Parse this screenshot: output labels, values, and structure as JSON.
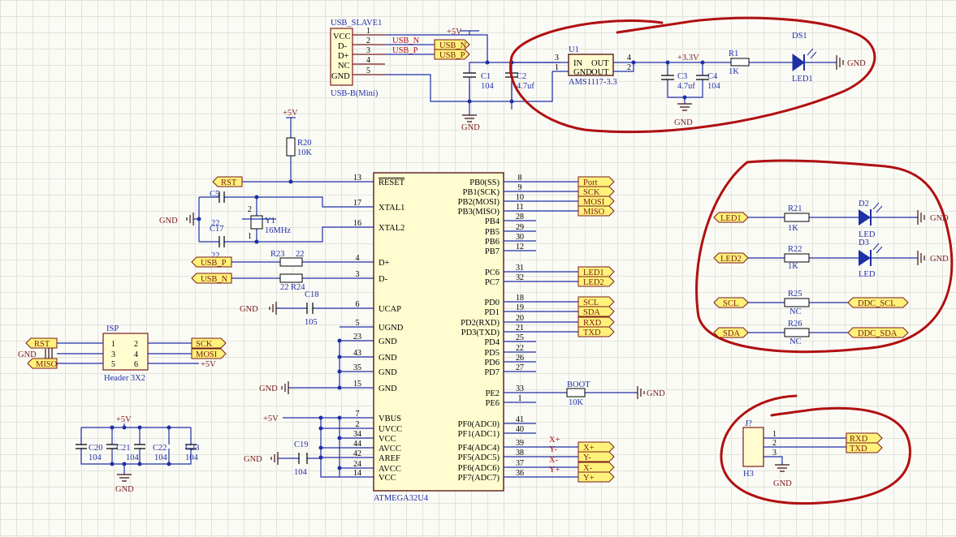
{
  "usb": {
    "ref": "USB_SLAVE1",
    "value": "USB-B(Mini)",
    "pins": [
      "VCC",
      "D-",
      "D+",
      "NC",
      "GND"
    ],
    "nums": [
      "1",
      "2",
      "3",
      "4",
      "5"
    ],
    "net_dm": "USB_N",
    "net_dp": "USB_P",
    "port_n": "USB_N",
    "port_p": "USB_P"
  },
  "power": {
    "plus5": "+5V",
    "plus33": "+3.3V",
    "gnd": "GND"
  },
  "reg": {
    "ref": "U1",
    "value": "AMS1117-3.3",
    "in": "IN",
    "out": "OUT",
    "gnd": "GND",
    "out2": "OUT",
    "p3": "3",
    "p1": "1",
    "p4": "4",
    "p2": "2"
  },
  "caps_top": {
    "c1": "C1",
    "c1v": "104",
    "c2": "C2",
    "c2v": "4.7uf",
    "c3": "C3",
    "c3v": "4.7uf",
    "c4": "C4",
    "c4v": "104"
  },
  "ds1": {
    "r1": "R1",
    "r1v": "1K",
    "ref": "DS1",
    "name": "LED1"
  },
  "mcu": {
    "value": "ATMEGA32U4",
    "left": [
      {
        "n": "13",
        "l": "RESET"
      },
      {
        "n": "17",
        "l": "XTAL1"
      },
      {
        "n": "16",
        "l": "XTAL2"
      },
      {
        "n": "4",
        "l": "D+"
      },
      {
        "n": "3",
        "l": "D-"
      },
      {
        "n": "6",
        "l": "UCAP"
      },
      {
        "n": "5",
        "l": "UGND"
      },
      {
        "n": "23",
        "l": "GND"
      },
      {
        "n": "43",
        "l": "GND"
      },
      {
        "n": "35",
        "l": "GND"
      },
      {
        "n": "15",
        "l": "GND"
      },
      {
        "n": "7",
        "l": "VBUS"
      },
      {
        "n": "2",
        "l": "UVCC"
      },
      {
        "n": "34",
        "l": "VCC"
      },
      {
        "n": "44",
        "l": "AVCC"
      },
      {
        "n": "42",
        "l": "AREF"
      },
      {
        "n": "24",
        "l": "AVCC"
      },
      {
        "n": "14",
        "l": "VCC"
      }
    ],
    "right": [
      {
        "n": "8",
        "l": "PB0(SS)"
      },
      {
        "n": "9",
        "l": "PB1(SCK)"
      },
      {
        "n": "10",
        "l": "PB2(MOSI)"
      },
      {
        "n": "11",
        "l": "PB3(MISO)"
      },
      {
        "n": "28",
        "l": "PB4"
      },
      {
        "n": "29",
        "l": "PB5"
      },
      {
        "n": "30",
        "l": "PB6"
      },
      {
        "n": "12",
        "l": "PB7"
      },
      {
        "n": "31",
        "l": "PC6"
      },
      {
        "n": "32",
        "l": "PC7"
      },
      {
        "n": "18",
        "l": "PD0"
      },
      {
        "n": "19",
        "l": "PD1"
      },
      {
        "n": "20",
        "l": "PD2(RXD)"
      },
      {
        "n": "21",
        "l": "PD3(TXD)"
      },
      {
        "n": "25",
        "l": "PD4"
      },
      {
        "n": "22",
        "l": "PD5"
      },
      {
        "n": "26",
        "l": "PD6"
      },
      {
        "n": "27",
        "l": "PD7"
      },
      {
        "n": "33",
        "l": "PE2"
      },
      {
        "n": "1",
        "l": "PE6"
      },
      {
        "n": "41",
        "l": "PF0(ADC0)"
      },
      {
        "n": "40",
        "l": "PF1(ADC1)"
      },
      {
        "n": "39",
        "l": "PF4(ADC4)"
      },
      {
        "n": "38",
        "l": "PF5(ADC5)"
      },
      {
        "n": "37",
        "l": "PF6(ADC6)"
      },
      {
        "n": "36",
        "l": "PF7(ADC7)"
      }
    ]
  },
  "ports_right": [
    "Port",
    "SCK",
    "MOSI",
    "MISO",
    "LED1",
    "LED2",
    "SCL",
    "SDA",
    "RXD",
    "TXD",
    "X+",
    "Y-",
    "X-",
    "Y+"
  ],
  "adc_nets": [
    "X+",
    "Y-",
    "X-",
    "Y+"
  ],
  "ports_left": {
    "rst": "RST",
    "usbp": "USB_P",
    "usbn": "USB_N"
  },
  "reset": {
    "r20": "R20",
    "r20v": "10K",
    "plus5": "+5V"
  },
  "xtal": {
    "c5": "C5",
    "c5v": "22",
    "c17": "C17",
    "c17v": "22",
    "y1": "Y1",
    "y1v": "16MHz",
    "p2": "2",
    "p1": "1",
    "gnd": "GND"
  },
  "usbres": {
    "r23": "R23",
    "r23v": "22",
    "r24": "R24",
    "r24v": "22"
  },
  "ucap": {
    "c18": "C18",
    "c18v": "105",
    "gnd": "GND"
  },
  "gnd_mcu": "GND",
  "vcc_mcu": {
    "plus5": "+5V",
    "c19": "C19",
    "c19v": "104",
    "gnd": "GND"
  },
  "boot": {
    "name": "BOOT",
    "r": "10K",
    "gnd": "GND"
  },
  "isp": {
    "ref": "ISP",
    "value": "Header 3X2",
    "nums": [
      "1",
      "2",
      "3",
      "4",
      "5",
      "6"
    ],
    "rst": "RST",
    "gnd": "GND",
    "miso": "MISO",
    "sck": "SCK",
    "mosi": "MOSI",
    "plus5": "+5V"
  },
  "decap": {
    "plus5": "+5V",
    "gnd": "GND",
    "refs": [
      "C20",
      "C21",
      "C22",
      "C23"
    ],
    "vals": [
      "104",
      "104",
      "104",
      "104"
    ]
  },
  "leds": {
    "led1": "LED1",
    "r21": "R21",
    "r21v": "1K",
    "d2": "D2",
    "d2n": "LED",
    "led2": "LED2",
    "r22": "R22",
    "r22v": "1K",
    "d3": "D3",
    "d3n": "LED",
    "scl": "SCL",
    "r25": "R25",
    "r25v": "NC",
    "ddc_scl": "DDC_SCL",
    "sda": "SDA",
    "r26": "R26",
    "r26v": "NC",
    "ddc_sda": "DDC_SDA",
    "gnd": "GND"
  },
  "h3": {
    "ref": "J?",
    "value": "H3",
    "nums": [
      "1",
      "2",
      "3"
    ],
    "rxd": "RXD",
    "txd": "TXD",
    "gnd": "GND"
  }
}
